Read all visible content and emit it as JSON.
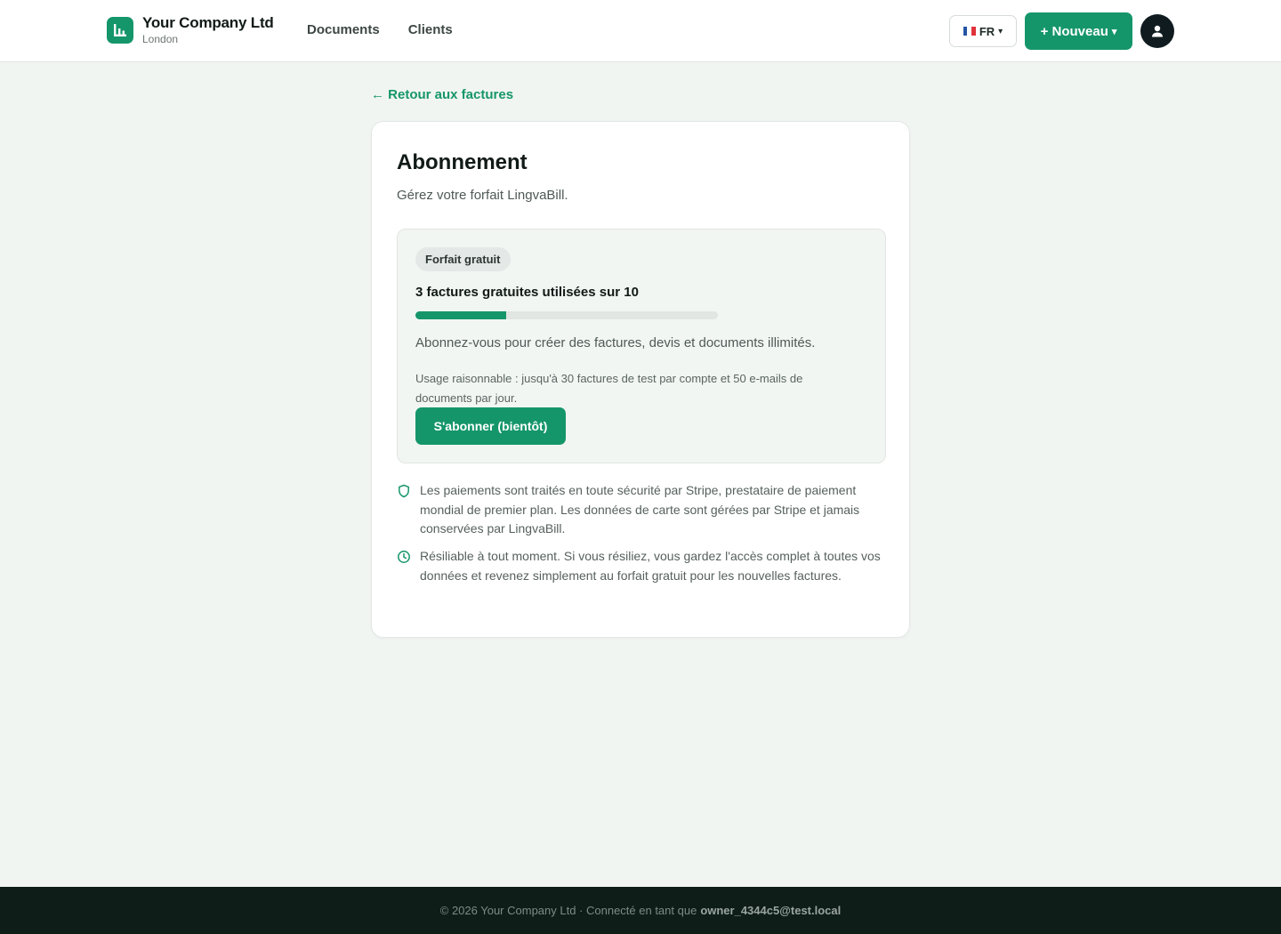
{
  "header": {
    "company_name": "Your Company Ltd",
    "company_city": "London",
    "nav": [
      {
        "label": "Documents"
      },
      {
        "label": "Clients"
      }
    ],
    "language": {
      "code": "FR",
      "caret": "▾",
      "flag": "france-flag-icon"
    },
    "new_button": {
      "label": "+ Nouveau",
      "caret": "▾"
    },
    "avatar": "user-icon"
  },
  "back_link": "← Retour aux factures",
  "card": {
    "title": "Abonnement",
    "subtitle": "Gérez votre forfait LingvaBill.",
    "plan": {
      "badge": "Forfait gratuit",
      "usage_text": "3 factures gratuites utilisées sur 10",
      "usage_used": 3,
      "usage_total": 10,
      "description": "Abonnez-vous pour créer des factures, devis et documents illimités.",
      "fair_use": "Usage raisonnable : jusqu'à 30 factures de test par compte et 50 e-mails de documents par jour.",
      "subscribe_label": "S'abonner (bientôt)"
    },
    "info": [
      {
        "icon": "shield-icon",
        "text": "Les paiements sont traités en toute sécurité par Stripe, prestataire de paiement mondial de premier plan. Les données de carte sont gérées par Stripe et jamais conservées par LingvaBill."
      },
      {
        "icon": "clock-icon",
        "text": "Résiliable à tout moment. Si vous résiliez, vous gardez l'accès complet à toutes vos données et revenez simplement au forfait gratuit pour les nouvelles factures."
      }
    ]
  },
  "footer": {
    "prefix": "© 2026 Your Company Ltd · Connecté en tant que",
    "email": "owner_4344c5@test.local"
  },
  "colors": {
    "accent": "#15966a",
    "background": "#f1f5f2",
    "footer": "#0e1d17"
  }
}
